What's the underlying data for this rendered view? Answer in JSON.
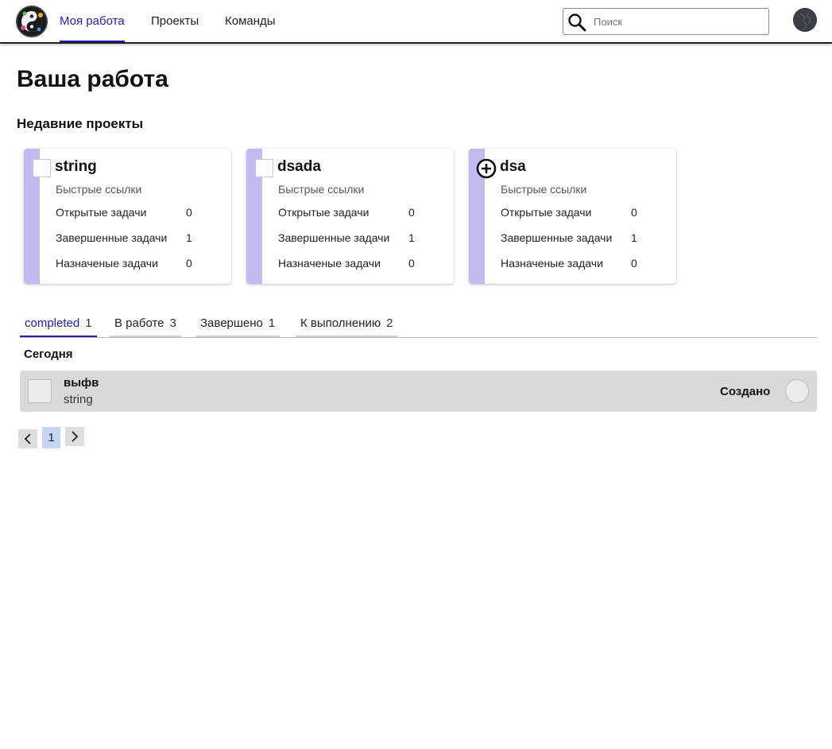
{
  "header": {
    "nav": [
      {
        "label": "Моя работа",
        "active": true
      },
      {
        "label": "Проекты",
        "active": false
      },
      {
        "label": "Команды",
        "active": false
      }
    ],
    "search": {
      "placeholder": "Поиск",
      "value": ""
    },
    "icons": {
      "logo": "app-logo-icon",
      "search": "search-icon",
      "avatar": "user-avatar"
    }
  },
  "page": {
    "title": "Ваша работа",
    "recent_title": "Недавние проекты"
  },
  "projects": [
    {
      "name": "string",
      "icon": "broken-image-icon",
      "quick_links": "Быстрые ссылки",
      "open_label": "Открытые задачи",
      "open_count": "0",
      "done_label": "Завершенные задачи",
      "done_count": "1",
      "assigned_label": "Назначеные задачи",
      "assigned_count": "0"
    },
    {
      "name": "dsada",
      "icon": "broken-image-icon",
      "quick_links": "Быстрые ссылки",
      "open_label": "Открытые задачи",
      "open_count": "0",
      "done_label": "Завершенные задачи",
      "done_count": "1",
      "assigned_label": "Назначеные задачи",
      "assigned_count": "0"
    },
    {
      "name": "dsa",
      "icon": "circle-plus-icon",
      "quick_links": "Быстрые ссылки",
      "open_label": "Открытые задачи",
      "open_count": "0",
      "done_label": "Завершенные задачи",
      "done_count": "1",
      "assigned_label": "Назначеные задачи",
      "assigned_count": "0"
    }
  ],
  "tabs": [
    {
      "label": "completed",
      "count": "1",
      "active": true
    },
    {
      "label": "В работе",
      "count": "3",
      "active": false
    },
    {
      "label": "Завершено",
      "count": "1",
      "active": false
    },
    {
      "label": "К выполнению",
      "count": "2",
      "active": false
    }
  ],
  "tasks": {
    "group_title": "Сегодня",
    "items": [
      {
        "title": "выфв",
        "project": "string",
        "status": "Создано"
      }
    ]
  },
  "pagination": {
    "current": "1",
    "prev_icon": "chevron-left-icon",
    "next_icon": "chevron-right-icon"
  },
  "colors": {
    "accent": "#1f1fb0",
    "card_stripe": "#c2bcf2",
    "row_bg": "#d9d9d9",
    "page_active": "#c5d5f5"
  }
}
